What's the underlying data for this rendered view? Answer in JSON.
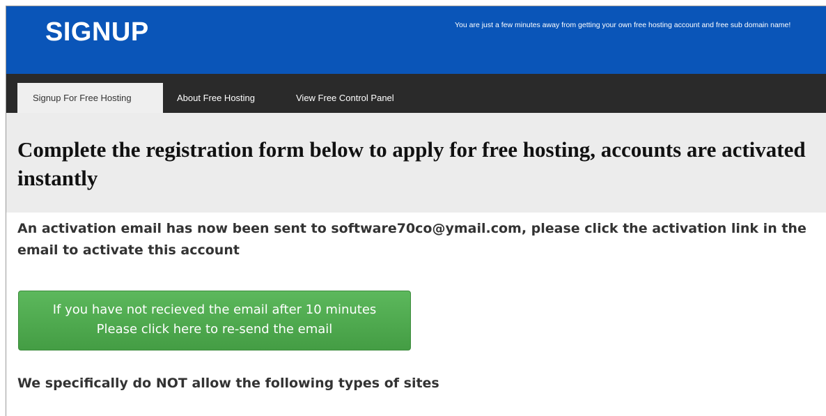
{
  "header": {
    "logo_text": "SIGNUP",
    "tagline": "You are just a few minutes away from getting your own free hosting account and free sub domain name!"
  },
  "nav": {
    "items": [
      {
        "label": "Signup For Free Hosting",
        "active": true
      },
      {
        "label": "About Free Hosting",
        "active": false
      },
      {
        "label": "View Free Control Panel",
        "active": false
      }
    ]
  },
  "main": {
    "heading": "Complete the registration form below to apply for free hosting, accounts are activated instantly",
    "activation_message": "An activation email has now been sent to software70co@ymail.com, please click the activation link in the email to activate this account",
    "resend_button": {
      "line1": "If you have not recieved the email after 10 minutes",
      "line2": "Please click here to re-send the email"
    },
    "restriction_heading": "We specifically do NOT allow the following types of sites"
  },
  "colors": {
    "header_bg": "#0a55b8",
    "nav_bg": "#2a2a2a",
    "heading_band_bg": "#ececec",
    "button_green": "#5cb85c"
  }
}
